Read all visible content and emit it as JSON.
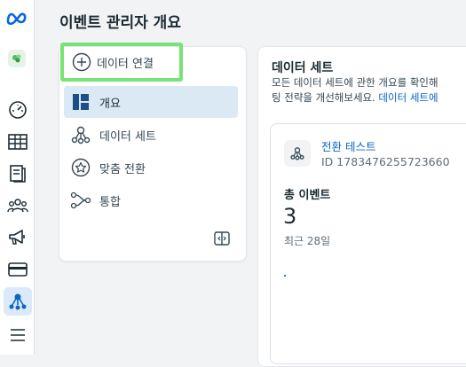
{
  "header": {
    "title": "이벤트 관리자 개요"
  },
  "sidebar_nav": {
    "connect_label": "데이터 연결",
    "items": [
      {
        "label": "개요",
        "icon": "overview-icon",
        "selected": true
      },
      {
        "label": "데이터 세트",
        "icon": "dataset-icon",
        "selected": false
      },
      {
        "label": "맞춤 전환",
        "icon": "star-icon",
        "selected": false
      },
      {
        "label": "통합",
        "icon": "integration-icon",
        "selected": false
      }
    ]
  },
  "main": {
    "section_title": "데이터 세트",
    "description_line1": "모든 데이터 세트에 관한 개요를 확인해",
    "description_line2": "팅 전략을 개선해보세요.",
    "description_link": "데이터 세트에",
    "dataset": {
      "name": "전환 테스트",
      "id": "ID 1783476255723660",
      "stat_label": "총 이벤트",
      "stat_value": "3",
      "stat_period": "최근 28일"
    }
  },
  "colors": {
    "accent": "#0a66c2",
    "highlight_outline": "#79e274",
    "selected_bg": "#dbe9f5",
    "meta_blue": "#0668e1"
  }
}
